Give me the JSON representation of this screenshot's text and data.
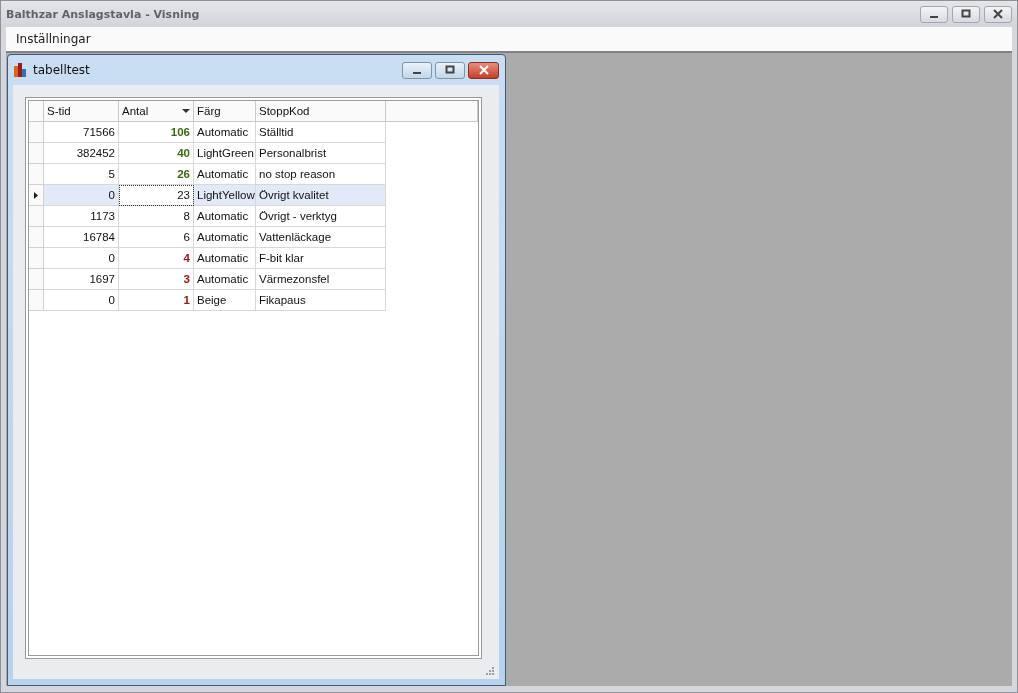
{
  "window": {
    "title": "Balthzar Anslagstavla - Visning"
  },
  "menu": [
    {
      "label": "Inställningar"
    }
  ],
  "child_window": {
    "title": "tabelltest"
  },
  "table": {
    "columns": [
      {
        "label": "S-tid",
        "sorted": false
      },
      {
        "label": "Antal",
        "sorted": true
      },
      {
        "label": "Färg",
        "sorted": false
      },
      {
        "label": "StoppKod",
        "sorted": false
      }
    ],
    "rows": [
      {
        "cells": [
          "71566",
          "106",
          "Automatic",
          "Ställtid"
        ],
        "color": "#3a6b10",
        "bold": true,
        "selected": false
      },
      {
        "cells": [
          "382452",
          "40",
          "LightGreen",
          "Personalbrist"
        ],
        "color": "#3a6b10",
        "bold": true,
        "selected": false
      },
      {
        "cells": [
          "5",
          "26",
          "Automatic",
          "no stop reason"
        ],
        "color": "#3a6b10",
        "bold": true,
        "selected": false
      },
      {
        "cells": [
          "0",
          "23",
          "LightYellow",
          "Övrigt kvalitet"
        ],
        "bold": false,
        "selected": true
      },
      {
        "cells": [
          "1173",
          "8",
          "Automatic",
          "Övrigt - verktyg"
        ],
        "bold": false,
        "selected": false
      },
      {
        "cells": [
          "16784",
          "6",
          "Automatic",
          "Vattenläckage"
        ],
        "bold": false,
        "selected": false
      },
      {
        "cells": [
          "0",
          "4",
          "Automatic",
          "F-bit klar"
        ],
        "color": "#a01818",
        "bold": true,
        "selected": false
      },
      {
        "cells": [
          "1697",
          "3",
          "Automatic",
          "Värmezonsfel"
        ],
        "color": "#a01818",
        "bold": true,
        "selected": false
      },
      {
        "cells": [
          "0",
          "1",
          "Beige",
          "Fikapaus"
        ],
        "color": "#a01818",
        "bold": true,
        "selected": false
      }
    ]
  }
}
